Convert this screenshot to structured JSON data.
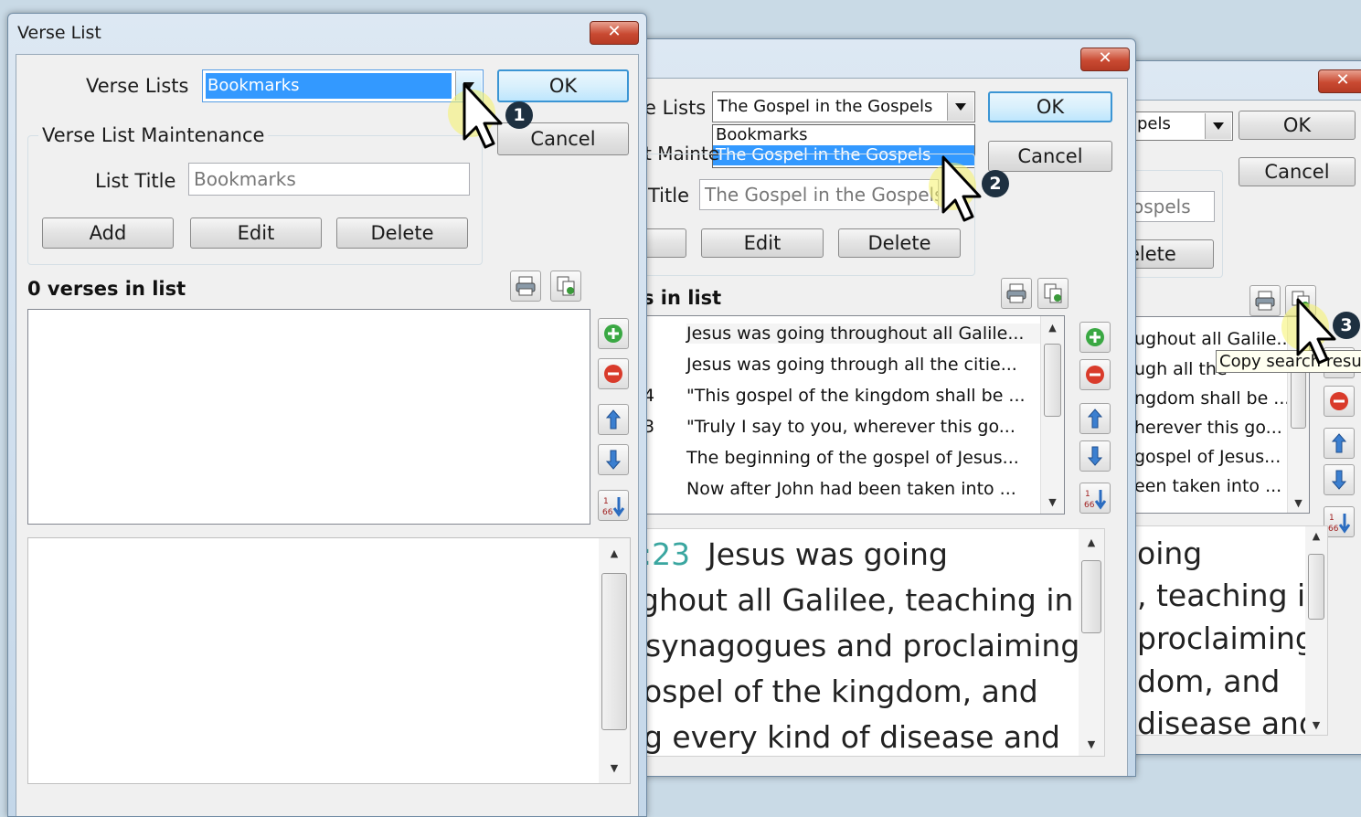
{
  "dialog1": {
    "title": "Verse List",
    "close_label": "✕",
    "verse_lists_label": "Verse Lists",
    "verse_lists_value": "Bookmarks",
    "ok_label": "OK",
    "cancel_label": "Cancel",
    "maintenance_label": "Verse List Maintenance",
    "list_title_label": "List Title",
    "list_title_value": "Bookmarks",
    "add_label": "Add",
    "edit_label": "Edit",
    "delete_label": "Delete",
    "count_label": "0 verses in list",
    "step": "1"
  },
  "dialog2": {
    "close_label": "✕",
    "verse_lists_label": "e Lists",
    "verse_lists_value": "The Gospel in the Gospels",
    "dropdown_options": [
      "Bookmarks",
      "The Gospel in the Gospels"
    ],
    "ok_label": "OK",
    "cancel_label": "Cancel",
    "maintenance_label": "t Mainte",
    "list_title_label": "Title",
    "list_title_value": "The Gospel in the Gospels",
    "edit_label": "Edit",
    "delete_label": "Delete",
    "count_label": "s in list",
    "verses": [
      "Jesus was going throughout all Galile...",
      "Jesus was going through all the citie...",
      "\"This gospel of the kingdom shall be ...",
      "\"Truly I say to you, wherever this go...",
      "The beginning of the gospel of Jesus...",
      "Now after John had been taken into ..."
    ],
    "verse_refs": [
      "",
      "",
      "4",
      "3",
      "",
      ""
    ],
    "preview_ref": ":23",
    "preview_lines": [
      "Jesus was going",
      "ghout all Galilee, teaching in",
      "synagogues and proclaiming",
      "ospel of the kingdom, and",
      "g every kind of disease and"
    ],
    "step": "2"
  },
  "dialog3": {
    "close_label": "✕",
    "combo_value": "pels",
    "ok_label": "OK",
    "cancel_label": "Cancel",
    "title_value": "ospels",
    "delete_label": "elete",
    "verses": [
      "ughout all Galile...",
      "ugh all the",
      "ngdom shall be ...",
      "herever this go...",
      "gospel of Jesus...",
      "een taken into ..."
    ],
    "tooltip": "Copy search result",
    "preview_lines": [
      "oing",
      ", teaching in",
      "proclaiming",
      "dom, and",
      "disease and"
    ],
    "step": "3"
  },
  "colors": {
    "accent_blue": "#3399ff",
    "reference_teal": "#3aa6a0"
  }
}
